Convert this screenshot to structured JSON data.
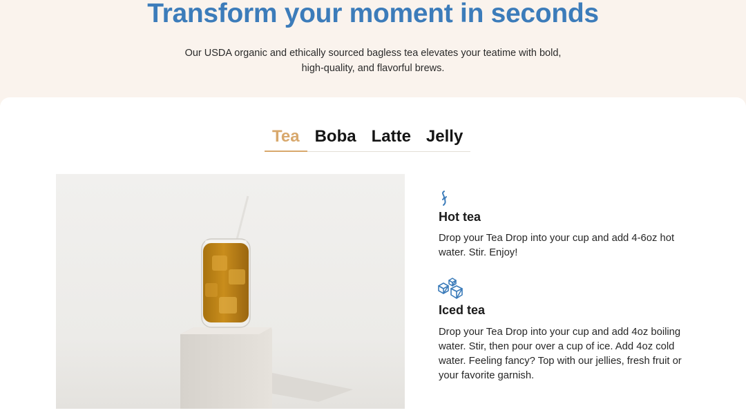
{
  "hero": {
    "title": "Transform your moment in seconds",
    "subtitle": "Our USDA organic and ethically sourced bagless tea elevates your teatime with bold, high-quality, and flavorful brews."
  },
  "tabs": [
    {
      "label": "Tea",
      "active": true
    },
    {
      "label": "Boba",
      "active": false
    },
    {
      "label": "Latte",
      "active": false
    },
    {
      "label": "Jelly",
      "active": false
    }
  ],
  "steps": [
    {
      "icon": "steam-icon",
      "title": "Hot tea",
      "body": "Drop your Tea Drop into your cup and add 4-6oz hot water. Stir. Enjoy!"
    },
    {
      "icon": "ice-cubes-icon",
      "title": "Iced tea",
      "body": "Drop your Tea Drop into your cup and add 4oz boiling water. Stir, then pour over a cup of ice. Add 4oz cold water. Feeling fancy? Top with our jellies, fresh fruit or your favorite garnish."
    }
  ],
  "colors": {
    "accent": "#3c7cba",
    "tab_active": "#d8a86c",
    "hero_bg": "#faf3ed"
  }
}
